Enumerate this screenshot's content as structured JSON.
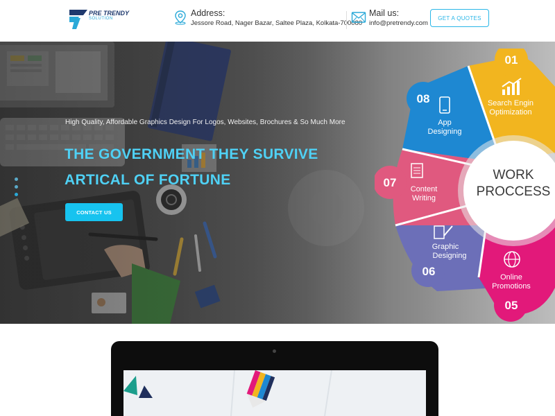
{
  "header": {
    "logo": {
      "name": "PRE TRENDY",
      "sub": "SOLUTION"
    },
    "address": {
      "label": "Address:",
      "value": "Jessore Road, Nager Bazar, Saltee Plaza, Kolkata-700080"
    },
    "mail": {
      "label": "Mail us:",
      "value": "info@pretrendy.com"
    },
    "quote_button": "GET A QUOTES"
  },
  "hero": {
    "tagline": "High Quality, Affordable Graphics Design For Logos, Websites, Brochures & So Much More",
    "title_line1": "THE GOVERNMENT THEY SURVIVE",
    "title_line2": "ARTICAL OF FORTUNE",
    "contact_button": "CONTACT US",
    "slider_dots": 3,
    "wheel": {
      "center": "WORK PROCCESS",
      "steps": [
        {
          "num": "01",
          "label1": "Search Engin",
          "label2": "Optimization",
          "color": "#f2b51f",
          "icon": "chart-up-icon"
        },
        {
          "num": "08",
          "label1": "App",
          "label2": "Designing",
          "color": "#1e88d2",
          "icon": "phone-icon"
        },
        {
          "num": "07",
          "label1": "Content",
          "label2": "Writing",
          "color": "#e0597f",
          "icon": "document-icon"
        },
        {
          "num": "06",
          "label1": "Graphic",
          "label2": "Designing",
          "color": "#6c6fb8",
          "icon": "pen-icon"
        },
        {
          "num": "05",
          "label1": "Online",
          "label2": "Promotions",
          "color": "#e2197a",
          "icon": "globe-icon"
        }
      ]
    }
  },
  "colors": {
    "accent": "#29b6e8",
    "title": "#4fd1f5",
    "button": "#17c3ef"
  }
}
